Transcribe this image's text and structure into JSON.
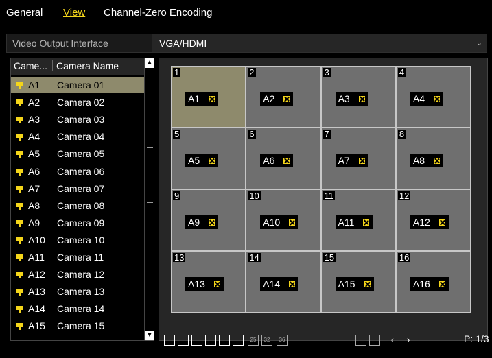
{
  "tabs": [
    "General",
    "View",
    "Channel-Zero Encoding"
  ],
  "video_output": {
    "label": "Video Output Interface",
    "value": "VGA/HDMI"
  },
  "camera_list": {
    "header_id": "Came...",
    "header_name": "Camera Name",
    "rows": [
      {
        "id": "A1",
        "name": "Camera 01"
      },
      {
        "id": "A2",
        "name": "Camera 02"
      },
      {
        "id": "A3",
        "name": "Camera 03"
      },
      {
        "id": "A4",
        "name": "Camera 04"
      },
      {
        "id": "A5",
        "name": "Camera 05"
      },
      {
        "id": "A6",
        "name": "Camera 06"
      },
      {
        "id": "A7",
        "name": "Camera 07"
      },
      {
        "id": "A8",
        "name": "Camera 08"
      },
      {
        "id": "A9",
        "name": "Camera 09"
      },
      {
        "id": "A10",
        "name": "Camera 10"
      },
      {
        "id": "A11",
        "name": "Camera 11"
      },
      {
        "id": "A12",
        "name": "Camera 12"
      },
      {
        "id": "A13",
        "name": "Camera 13"
      },
      {
        "id": "A14",
        "name": "Camera 14"
      },
      {
        "id": "A15",
        "name": "Camera 15"
      }
    ],
    "selected": "A1"
  },
  "grid_cells": [
    {
      "num": "1",
      "label": "A1"
    },
    {
      "num": "2",
      "label": "A2"
    },
    {
      "num": "3",
      "label": "A3"
    },
    {
      "num": "4",
      "label": "A4"
    },
    {
      "num": "5",
      "label": "A5"
    },
    {
      "num": "6",
      "label": "A6"
    },
    {
      "num": "7",
      "label": "A7"
    },
    {
      "num": "8",
      "label": "A8"
    },
    {
      "num": "9",
      "label": "A9"
    },
    {
      "num": "10",
      "label": "A10"
    },
    {
      "num": "11",
      "label": "A11"
    },
    {
      "num": "12",
      "label": "A12"
    },
    {
      "num": "13",
      "label": "A13"
    },
    {
      "num": "14",
      "label": "A14"
    },
    {
      "num": "15",
      "label": "A15"
    },
    {
      "num": "16",
      "label": "A16"
    }
  ],
  "toolbar": {
    "layout_buttons": [
      "layout-1-icon",
      "layout-4-icon",
      "layout-6-icon",
      "layout-8-icon",
      "layout-9-icon",
      "layout-16-icon",
      "layout-25-icon",
      "layout-32-icon",
      "layout-36-icon"
    ],
    "layout_labels": [
      "",
      "",
      "",
      "",
      "",
      "",
      "25",
      "32",
      "36"
    ],
    "page": "P: 1/3"
  },
  "colors": {
    "accent": "#f4d51a",
    "selected": "#8e8a6c",
    "cell": "#6f6f6f"
  }
}
